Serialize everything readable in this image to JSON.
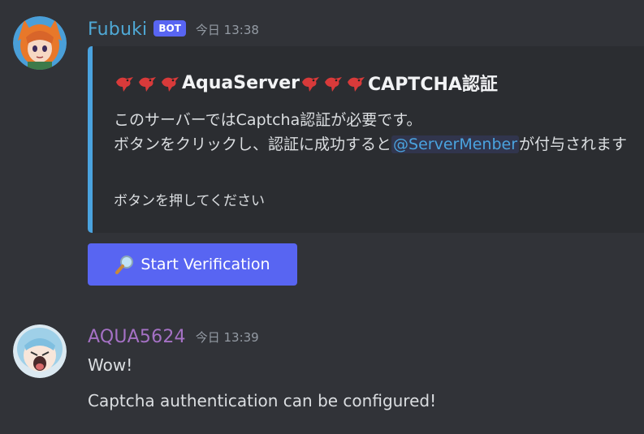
{
  "messages": [
    {
      "username": "Fubuki",
      "badge": "BOT",
      "timestamp": "今日 13:38",
      "avatar_icon": "fox-girl-avatar",
      "embed": {
        "title_birds_left": "bird-emoji",
        "title_middle": "AquaServer",
        "title_end": "CAPTCHA認証",
        "description_line1": "このサーバーではCaptcha認証が必要です。",
        "description_line2_pre": "ボタンをクリックし、認証に成功すると",
        "mention": "@ServerMenber",
        "description_line2_post": "が付与されます",
        "footer": "ボタンを押してください",
        "accent_color": "#4aa3df"
      },
      "button": {
        "icon": "magnifying-glass-icon",
        "label": "Start Verification",
        "color": "#5865f2"
      }
    },
    {
      "username": "AQUA5624",
      "timestamp": "今日 13:39",
      "avatar_icon": "aqua-avatar",
      "lines": [
        "Wow!",
        "Captcha authentication can be configured!"
      ]
    }
  ]
}
